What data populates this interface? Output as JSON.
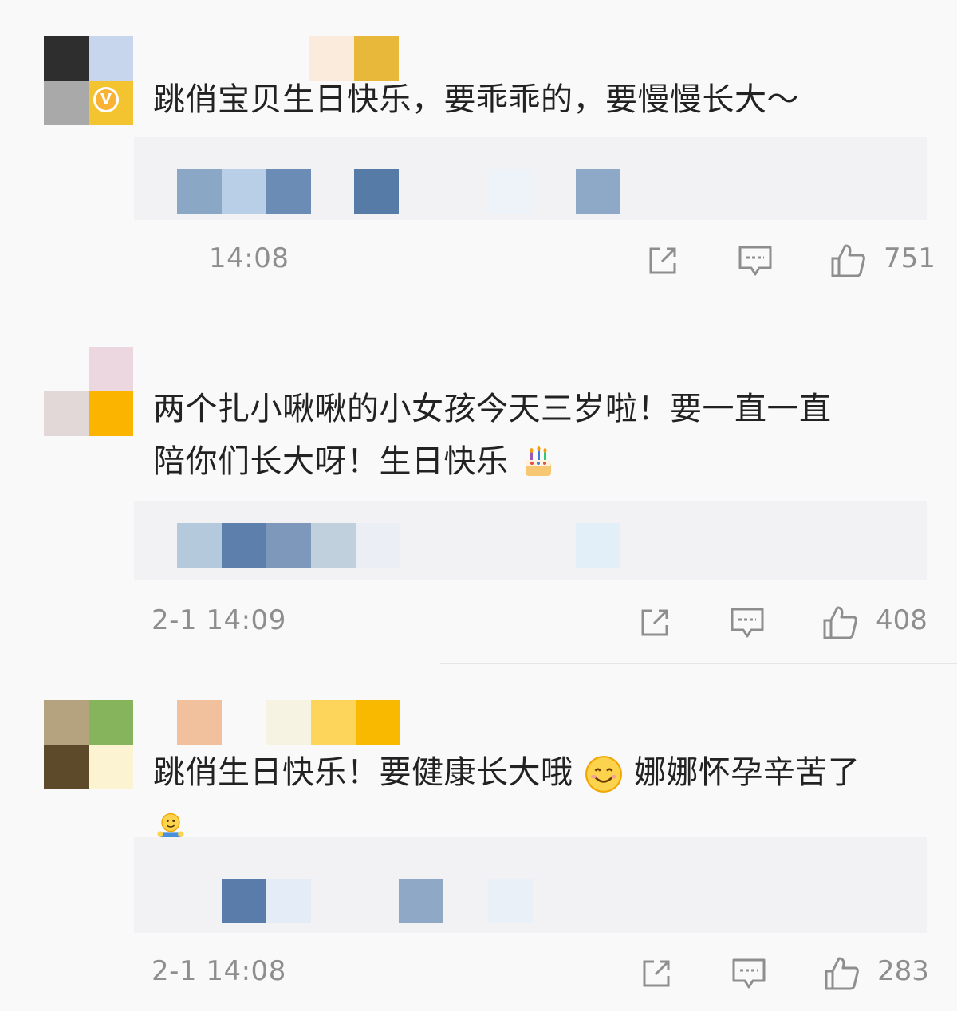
{
  "comments": [
    {
      "text": "跳俏宝贝生日快乐，要乖乖的，要慢慢长大～",
      "timestamp": "14:08",
      "like_count": "751",
      "verified_badge": "V"
    },
    {
      "text_line1": "两个扎小啾啾的小女孩今天三岁啦！要一直一直",
      "text_line2": "陪你们长大呀！生日快乐",
      "emoji": "birthday-cake",
      "timestamp": "2-1 14:09",
      "like_count": "408"
    },
    {
      "text_line1": "跳俏生日快乐！要健康长大哦",
      "text_line1_emoji": "smiling-face",
      "text_line1_after": "娜娜怀孕辛苦了",
      "emoji_line2": "hug-emoji",
      "timestamp": "2-1 14:08",
      "like_count": "283"
    }
  ],
  "icons": {
    "share": "share-icon",
    "reply": "comment-icon",
    "like": "thumbs-up-icon"
  },
  "colors": {
    "text": "#222222",
    "meta": "#8e8e8e",
    "badge": "#f9b233",
    "divider": "#e6e6e6"
  }
}
